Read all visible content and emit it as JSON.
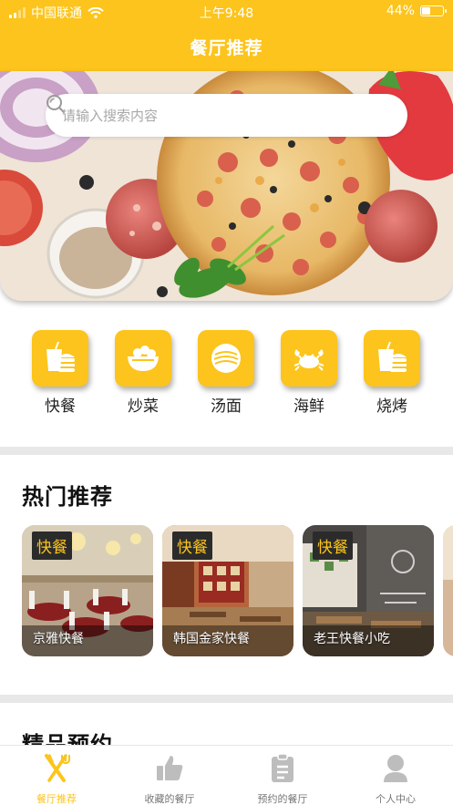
{
  "status_bar": {
    "carrier": "中国联通",
    "time": "上午9:48",
    "battery": "44%",
    "battery_level": 0.44
  },
  "header": {
    "title": "餐厅推荐"
  },
  "search": {
    "placeholder": "请输入搜索内容",
    "icon": "search-icon"
  },
  "categories": [
    {
      "label": "快餐",
      "icon": "fast-food-icon"
    },
    {
      "label": "炒菜",
      "icon": "stir-fry-bowl-icon"
    },
    {
      "label": "汤面",
      "icon": "noodle-bowl-icon"
    },
    {
      "label": "海鲜",
      "icon": "crab-icon"
    },
    {
      "label": "烧烤",
      "icon": "fast-food-icon"
    }
  ],
  "hot": {
    "title": "热门推荐",
    "cards": [
      {
        "tag": "快餐",
        "name": "京雅快餐"
      },
      {
        "tag": "快餐",
        "name": "韩国金家快餐"
      },
      {
        "tag": "快餐",
        "name": "老王快餐小吃"
      }
    ]
  },
  "premium": {
    "title": "精品预约"
  },
  "tabbar": {
    "items": [
      {
        "label": "餐厅推荐",
        "icon": "fork-knife-icon",
        "active": true
      },
      {
        "label": "收藏的餐厅",
        "icon": "thumbs-up-icon",
        "active": false
      },
      {
        "label": "预约的餐厅",
        "icon": "clipboard-icon",
        "active": false
      },
      {
        "label": "个人中心",
        "icon": "person-icon",
        "active": false
      }
    ]
  },
  "colors": {
    "accent": "#fcc41c",
    "tag_bg": "#2b2b2b",
    "inactive": "#bdbdbd"
  }
}
